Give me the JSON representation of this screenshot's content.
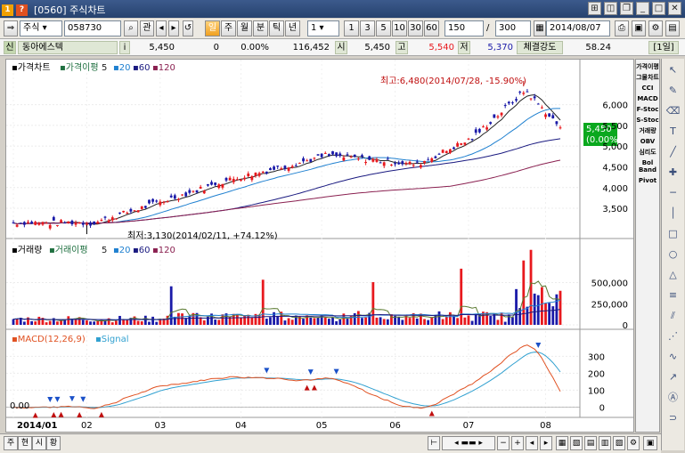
{
  "window": {
    "badge1": "1",
    "badge2": "?",
    "title": "[0560] 주식차트"
  },
  "toolbar": {
    "market": "주식",
    "code": "058730",
    "tab_kwan": "관",
    "period_buttons": [
      "일",
      "주",
      "월",
      "분",
      "틱",
      "년"
    ],
    "interval_value": "1",
    "interval_buttons": [
      "1",
      "3",
      "5",
      "10",
      "30",
      "60"
    ],
    "count_value": "150",
    "total_value": "300",
    "date": "2014/08/07"
  },
  "quote": {
    "flag": "신",
    "name": "동아에스텍",
    "info": "i",
    "price": "5,450",
    "change": "0",
    "rate": "0.00%",
    "volume": "116,452",
    "open_label": "시",
    "open": "5,450",
    "high_label": "고",
    "high": "5,540",
    "low_label": "저",
    "low": "5,370",
    "strength_label": "체결강도",
    "strength": "58.24",
    "period_label": "[1일]"
  },
  "price_panel": {
    "title": "가격차트",
    "ma_title": "가격이평",
    "ma_periods": [
      "5",
      "20",
      "60",
      "120"
    ],
    "high_annotation": "최고:6,480(2014/07/28, -15.90%)",
    "low_annotation": "최저:3,130(2014/02/11, +74.12%)",
    "current_price": "5,450",
    "current_rate": "(0.00%)",
    "y_ticks": [
      "6,000",
      "5,500",
      "5,000",
      "4,500",
      "4,000",
      "3,500"
    ]
  },
  "volume_panel": {
    "title": "거래량",
    "ma_title": "거래이평",
    "ma_periods": [
      "5",
      "20",
      "60",
      "120"
    ],
    "y_ticks": [
      "500,000",
      "250,000",
      "0"
    ]
  },
  "macd_panel": {
    "title": "MACD(12,26,9)",
    "signal": "Signal",
    "zero_label": "0.00",
    "y_ticks": [
      "300",
      "200",
      "100",
      "0"
    ]
  },
  "x_axis": {
    "labels": [
      "2014/01",
      "02",
      "03",
      "04",
      "05",
      "06",
      "07",
      "08"
    ]
  },
  "right_indicators": [
    "가격이평",
    "그물차트",
    "CCI",
    "MACD",
    "F-Stoc",
    "S-Stoc",
    "거래량",
    "OBV",
    "심리도",
    "Bol Band",
    "Pivot"
  ],
  "bottom_tabs": [
    "주",
    "현",
    "시",
    "황"
  ],
  "colors": {
    "up": "#e8191e",
    "down": "#1a1aa8",
    "ma5": "#222222",
    "ma20": "#1f80d0",
    "ma60": "#1a1a80",
    "ma120": "#8a2050",
    "macd": "#e05020",
    "signal": "#30a0d0",
    "current_box": "#0aa81e"
  }
}
